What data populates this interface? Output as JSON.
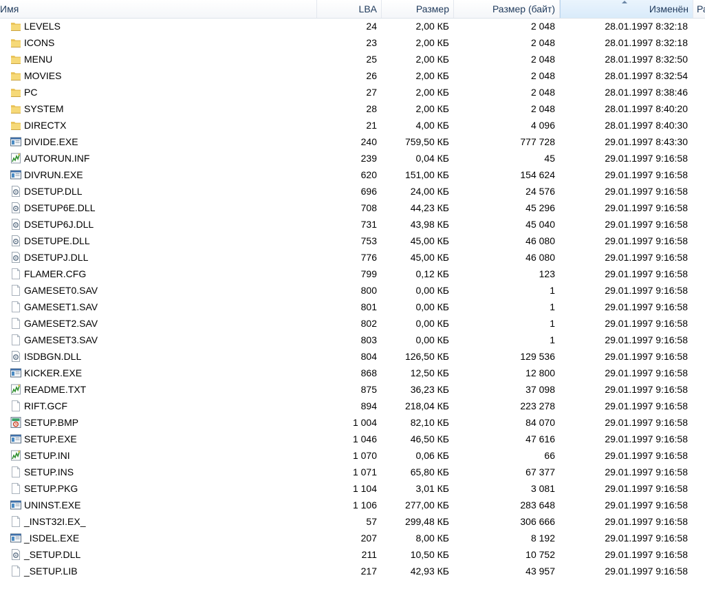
{
  "columns": {
    "name": "Имя",
    "lba": "LBA",
    "size": "Размер",
    "size_bytes": "Размер (байт)",
    "modified": "Изменён",
    "extra": "Ра"
  },
  "files": [
    {
      "name": "LEVELS",
      "icon": "folder-icon",
      "lba": "24",
      "size": "2,00 КБ",
      "bytes": "2 048",
      "modified": "28.01.1997 8:32:18"
    },
    {
      "name": "ICONS",
      "icon": "folder-icon",
      "lba": "23",
      "size": "2,00 КБ",
      "bytes": "2 048",
      "modified": "28.01.1997 8:32:18"
    },
    {
      "name": "MENU",
      "icon": "folder-icon",
      "lba": "25",
      "size": "2,00 КБ",
      "bytes": "2 048",
      "modified": "28.01.1997 8:32:50"
    },
    {
      "name": "MOVIES",
      "icon": "folder-icon",
      "lba": "26",
      "size": "2,00 КБ",
      "bytes": "2 048",
      "modified": "28.01.1997 8:32:54"
    },
    {
      "name": "PC",
      "icon": "folder-icon",
      "lba": "27",
      "size": "2,00 КБ",
      "bytes": "2 048",
      "modified": "28.01.1997 8:38:46"
    },
    {
      "name": "SYSTEM",
      "icon": "folder-icon",
      "lba": "28",
      "size": "2,00 КБ",
      "bytes": "2 048",
      "modified": "28.01.1997 8:40:20"
    },
    {
      "name": "DIRECTX",
      "icon": "folder-icon",
      "lba": "21",
      "size": "4,00 КБ",
      "bytes": "4 096",
      "modified": "28.01.1997 8:40:30"
    },
    {
      "name": "DIVIDE.EXE",
      "icon": "executable-icon",
      "lba": "240",
      "size": "759,50 КБ",
      "bytes": "777 728",
      "modified": "29.01.1997 8:43:30"
    },
    {
      "name": "AUTORUN.INF",
      "icon": "settings-file-icon",
      "lba": "239",
      "size": "0,04 КБ",
      "bytes": "45",
      "modified": "29.01.1997 9:16:58"
    },
    {
      "name": "DIVRUN.EXE",
      "icon": "executable-icon",
      "lba": "620",
      "size": "151,00 КБ",
      "bytes": "154 624",
      "modified": "29.01.1997 9:16:58"
    },
    {
      "name": "DSETUP.DLL",
      "icon": "dll-file-icon",
      "lba": "696",
      "size": "24,00 КБ",
      "bytes": "24 576",
      "modified": "29.01.1997 9:16:58"
    },
    {
      "name": "DSETUP6E.DLL",
      "icon": "dll-file-icon",
      "lba": "708",
      "size": "44,23 КБ",
      "bytes": "45 296",
      "modified": "29.01.1997 9:16:58"
    },
    {
      "name": "DSETUP6J.DLL",
      "icon": "dll-file-icon",
      "lba": "731",
      "size": "43,98 КБ",
      "bytes": "45 040",
      "modified": "29.01.1997 9:16:58"
    },
    {
      "name": "DSETUPE.DLL",
      "icon": "dll-file-icon",
      "lba": "753",
      "size": "45,00 КБ",
      "bytes": "46 080",
      "modified": "29.01.1997 9:16:58"
    },
    {
      "name": "DSETUPJ.DLL",
      "icon": "dll-file-icon",
      "lba": "776",
      "size": "45,00 КБ",
      "bytes": "46 080",
      "modified": "29.01.1997 9:16:58"
    },
    {
      "name": "FLAMER.CFG",
      "icon": "blank-file-icon",
      "lba": "799",
      "size": "0,12 КБ",
      "bytes": "123",
      "modified": "29.01.1997 9:16:58"
    },
    {
      "name": "GAMESET0.SAV",
      "icon": "blank-file-icon",
      "lba": "800",
      "size": "0,00 КБ",
      "bytes": "1",
      "modified": "29.01.1997 9:16:58"
    },
    {
      "name": "GAMESET1.SAV",
      "icon": "blank-file-icon",
      "lba": "801",
      "size": "0,00 КБ",
      "bytes": "1",
      "modified": "29.01.1997 9:16:58"
    },
    {
      "name": "GAMESET2.SAV",
      "icon": "blank-file-icon",
      "lba": "802",
      "size": "0,00 КБ",
      "bytes": "1",
      "modified": "29.01.1997 9:16:58"
    },
    {
      "name": "GAMESET3.SAV",
      "icon": "blank-file-icon",
      "lba": "803",
      "size": "0,00 КБ",
      "bytes": "1",
      "modified": "29.01.1997 9:16:58"
    },
    {
      "name": "ISDBGN.DLL",
      "icon": "dll-file-icon",
      "lba": "804",
      "size": "126,50 КБ",
      "bytes": "129 536",
      "modified": "29.01.1997 9:16:58"
    },
    {
      "name": "KICKER.EXE",
      "icon": "executable-icon",
      "lba": "868",
      "size": "12,50 КБ",
      "bytes": "12 800",
      "modified": "29.01.1997 9:16:58"
    },
    {
      "name": "README.TXT",
      "icon": "settings-file-icon",
      "lba": "875",
      "size": "36,23 КБ",
      "bytes": "37 098",
      "modified": "29.01.1997 9:16:58"
    },
    {
      "name": "RIFT.GCF",
      "icon": "blank-file-icon",
      "lba": "894",
      "size": "218,04 КБ",
      "bytes": "223 278",
      "modified": "29.01.1997 9:16:58"
    },
    {
      "name": "SETUP.BMP",
      "icon": "bitmap-file-icon",
      "lba": "1 004",
      "size": "82,10 КБ",
      "bytes": "84 070",
      "modified": "29.01.1997 9:16:58"
    },
    {
      "name": "SETUP.EXE",
      "icon": "executable-icon",
      "lba": "1 046",
      "size": "46,50 КБ",
      "bytes": "47 616",
      "modified": "29.01.1997 9:16:58"
    },
    {
      "name": "SETUP.INI",
      "icon": "settings-file-icon",
      "lba": "1 070",
      "size": "0,06 КБ",
      "bytes": "66",
      "modified": "29.01.1997 9:16:58"
    },
    {
      "name": "SETUP.INS",
      "icon": "blank-file-icon",
      "lba": "1 071",
      "size": "65,80 КБ",
      "bytes": "67 377",
      "modified": "29.01.1997 9:16:58"
    },
    {
      "name": "SETUP.PKG",
      "icon": "blank-file-icon",
      "lba": "1 104",
      "size": "3,01 КБ",
      "bytes": "3 081",
      "modified": "29.01.1997 9:16:58"
    },
    {
      "name": "UNINST.EXE",
      "icon": "executable-icon",
      "lba": "1 106",
      "size": "277,00 КБ",
      "bytes": "283 648",
      "modified": "29.01.1997 9:16:58"
    },
    {
      "name": "_INST32I.EX_",
      "icon": "blank-file-icon",
      "lba": "57",
      "size": "299,48 КБ",
      "bytes": "306 666",
      "modified": "29.01.1997 9:16:58"
    },
    {
      "name": "_ISDEL.EXE",
      "icon": "executable-icon",
      "lba": "207",
      "size": "8,00 КБ",
      "bytes": "8 192",
      "modified": "29.01.1997 9:16:58"
    },
    {
      "name": "_SETUP.DLL",
      "icon": "dll-file-icon",
      "lba": "211",
      "size": "10,50 КБ",
      "bytes": "10 752",
      "modified": "29.01.1997 9:16:58"
    },
    {
      "name": "_SETUP.LIB",
      "icon": "blank-file-icon",
      "lba": "217",
      "size": "42,93 КБ",
      "bytes": "43 957",
      "modified": "29.01.1997 9:16:58"
    }
  ]
}
